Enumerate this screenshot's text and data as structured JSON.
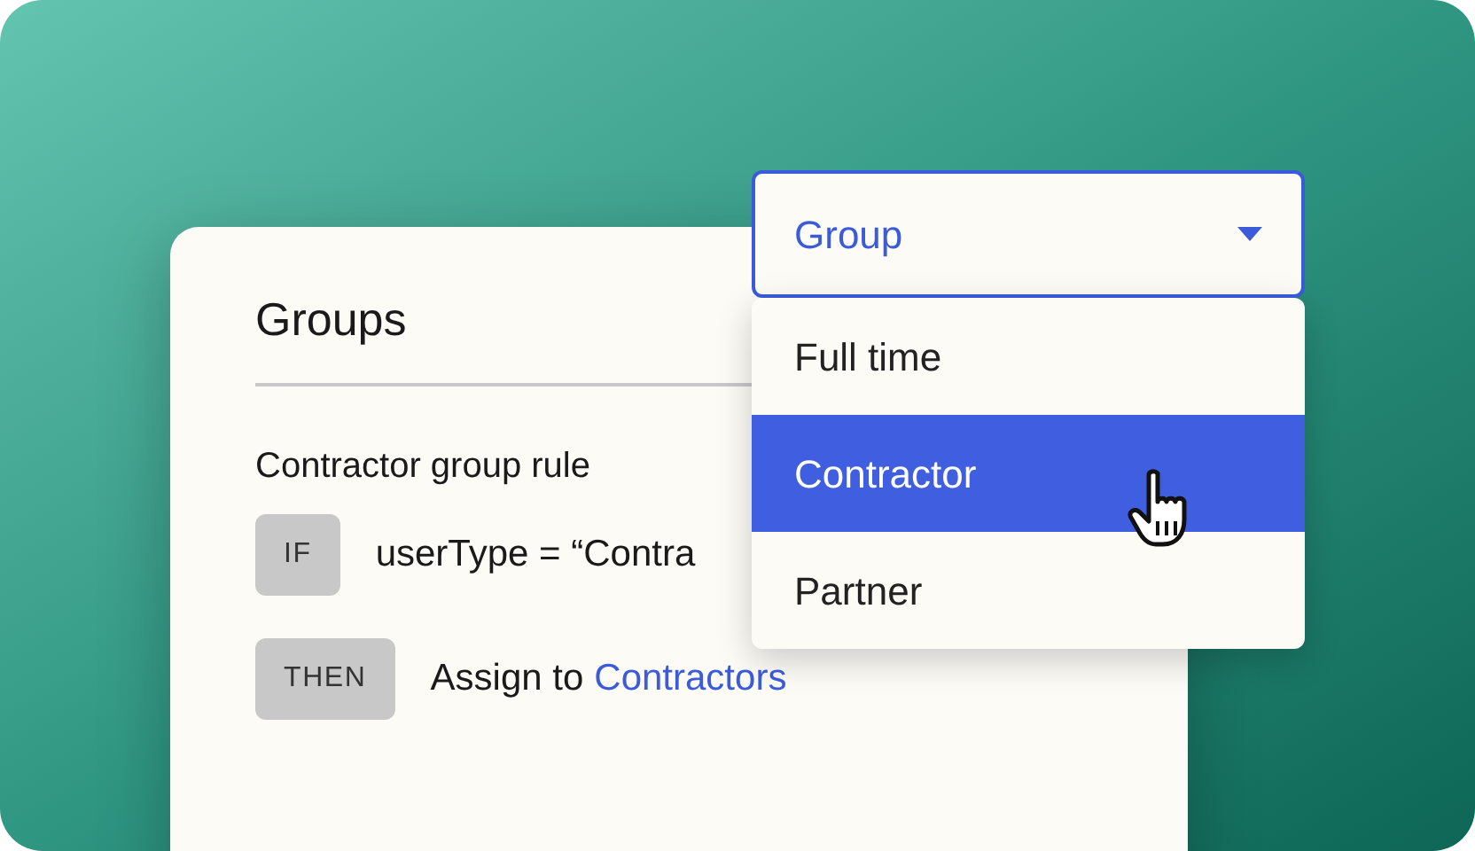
{
  "card": {
    "title": "Groups",
    "rule_title": "Contractor group rule",
    "rules": [
      {
        "keyword": "IF",
        "text": "userType = “Contra"
      },
      {
        "keyword": "THEN",
        "text": "Assign to",
        "link": "Contractors"
      }
    ]
  },
  "dropdown": {
    "value": "Group",
    "expanded": true,
    "options": [
      {
        "label": "Full time",
        "selected": false
      },
      {
        "label": "Contractor",
        "selected": true
      },
      {
        "label": "Partner",
        "selected": false
      }
    ]
  }
}
